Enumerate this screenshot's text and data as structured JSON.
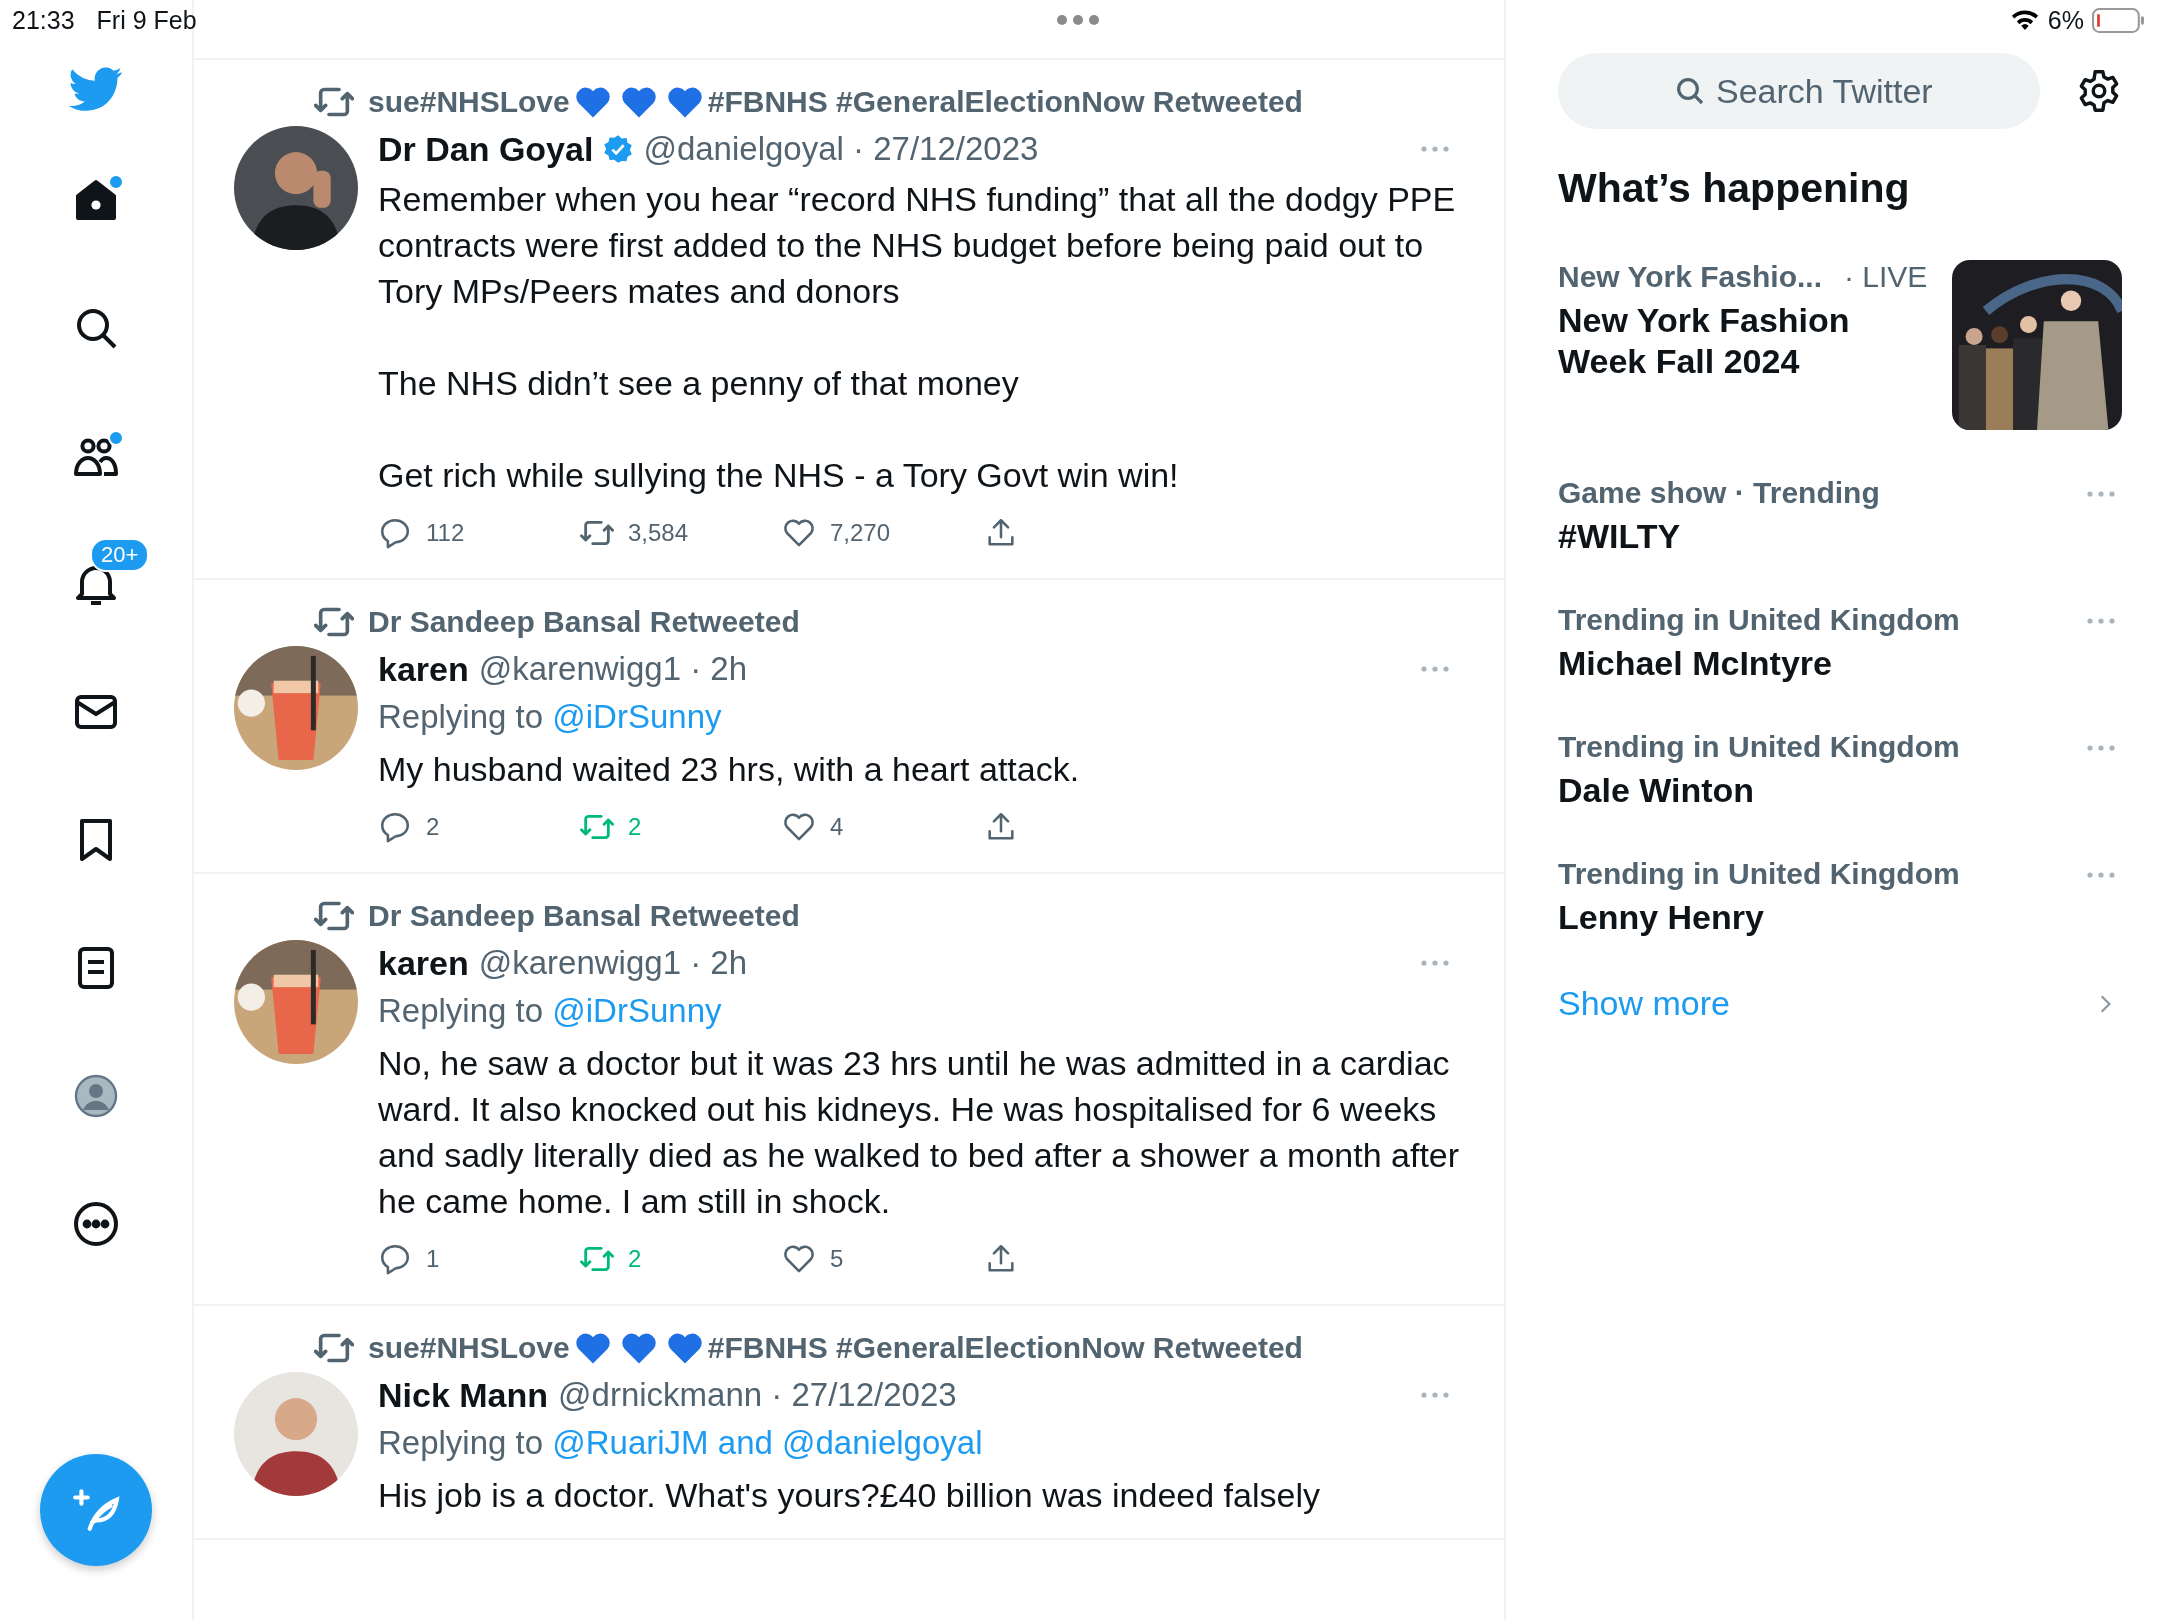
{
  "status_bar": {
    "time": "21:33",
    "date": "Fri 9 Feb",
    "battery": "6%"
  },
  "sidebar": {
    "items": [
      {
        "kind": "home",
        "dot": true
      },
      {
        "kind": "search",
        "dot": false
      },
      {
        "kind": "communities",
        "dot": true
      },
      {
        "kind": "notifications",
        "dot": false,
        "badge": "20+"
      },
      {
        "kind": "messages",
        "dot": false
      },
      {
        "kind": "bookmarks",
        "dot": false
      },
      {
        "kind": "lists",
        "dot": false
      },
      {
        "kind": "profile",
        "dot": false
      },
      {
        "kind": "more",
        "dot": false
      }
    ]
  },
  "tweets": [
    {
      "retweeted_by": [
        {
          "kind": "text",
          "text": "sue#NHSLove"
        },
        {
          "kind": "heart"
        },
        {
          "kind": "heart"
        },
        {
          "kind": "heart"
        },
        {
          "kind": "text",
          "text": "#FBNHS #GeneralElectionNow Retweeted"
        }
      ],
      "author": "Dr Dan Goyal",
      "verified": true,
      "handle": "@danielgoyal",
      "time": "· 27/12/2023",
      "text": [
        "Remember when you hear “record NHS funding” that all the dodgy PPE contracts were first added to the NHS budget before being paid out to Tory MPs/Peers mates and donors",
        "The NHS didn’t see a penny of that money",
        "Get rich while sullying the NHS - a Tory Govt win win!"
      ],
      "replies": "112",
      "retweets": "3,584",
      "likes": "7,270",
      "retweeted": false
    },
    {
      "retweeted_by": [
        {
          "kind": "text",
          "text": "Dr Sandeep Bansal Retweeted"
        }
      ],
      "author": "karen",
      "verified": false,
      "handle": "@karenwigg1",
      "time": "· 2h",
      "replying_prefix": "Replying to",
      "replying_to": "@iDrSunny",
      "text": [
        "My husband waited 23 hrs, with a heart attack."
      ],
      "replies": "2",
      "retweets": "2",
      "likes": "4",
      "retweeted": true
    },
    {
      "retweeted_by": [
        {
          "kind": "text",
          "text": "Dr Sandeep Bansal Retweeted"
        }
      ],
      "author": "karen",
      "verified": false,
      "handle": "@karenwigg1",
      "time": "· 2h",
      "replying_prefix": "Replying to",
      "replying_to": "@iDrSunny",
      "text": [
        "No, he saw a doctor but it was 23 hrs until he was admitted in a cardiac ward. It also knocked out his kidneys. He was hospitalised for 6 weeks and sadly literally died as he walked to bed after a shower a month after he came home. I am still in shock."
      ],
      "replies": "1",
      "retweets": "2",
      "likes": "5",
      "retweeted": true
    },
    {
      "retweeted_by": [
        {
          "kind": "text",
          "text": "sue#NHSLove"
        },
        {
          "kind": "heart"
        },
        {
          "kind": "heart"
        },
        {
          "kind": "heart"
        },
        {
          "kind": "text",
          "text": "#FBNHS #GeneralElectionNow Retweeted"
        }
      ],
      "author": "Nick Mann",
      "verified": false,
      "handle": "@drnickmann",
      "time": "· 27/12/2023",
      "replying_prefix": "Replying to",
      "replying_to": "@RuariJM and @danielgoyal",
      "text": [
        "His job is a doctor. What's yours?£40 billion was indeed falsely"
      ]
    }
  ],
  "search": {
    "placeholder": "Search Twitter"
  },
  "whats_happening": {
    "title": "What’s happening",
    "trends": [
      {
        "category": "New York Fashio...",
        "live": "· LIVE",
        "title": "New York Fashion Week Fall 2024",
        "kind": "picture"
      },
      {
        "category": "Game show · Trending",
        "title": "#WILTY",
        "kind": "more"
      },
      {
        "category": "Trending in United Kingdom",
        "title": "Michael McIntyre",
        "kind": "more"
      },
      {
        "category": "Trending in United Kingdom",
        "title": "Dale Winton",
        "kind": "more"
      },
      {
        "category": "Trending in United Kingdom",
        "title": "Lenny Henry",
        "kind": "more"
      }
    ],
    "show_more": "Show more"
  }
}
